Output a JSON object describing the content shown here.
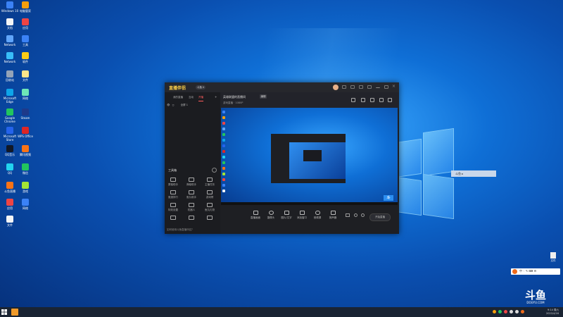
{
  "desktop": {
    "icons": [
      {
        "label": "Windows 10",
        "color": "#3b82f6"
      },
      {
        "label": "电脑管家",
        "color": "#f59e0b"
      },
      {
        "label": "文档",
        "color": "#f3f4f6"
      },
      {
        "label": "应用",
        "color": "#ef4444"
      },
      {
        "label": "Network",
        "color": "#60a5fa"
      },
      {
        "label": "工具",
        "color": "#3b82f6"
      },
      {
        "label": "Network",
        "color": "#38bdf8"
      },
      {
        "label": "软件",
        "color": "#facc15"
      },
      {
        "label": "回收站",
        "color": "#94a3b8"
      },
      {
        "label": "文件",
        "color": "#fde68a"
      },
      {
        "label": "Microsoft Edge",
        "color": "#0ea5e9"
      },
      {
        "label": "网络",
        "color": "#6ee7b7"
      },
      {
        "label": "Google Chrome",
        "color": "#22c55e"
      },
      {
        "label": "Steam",
        "color": "#1e3a8a"
      },
      {
        "label": "Microsoft Store",
        "color": "#2563eb"
      },
      {
        "label": "WPS Office",
        "color": "#dc2626"
      },
      {
        "label": "QQ音乐",
        "color": "#111827"
      },
      {
        "label": "腾讯视频",
        "color": "#f97316"
      },
      {
        "label": "QQ",
        "color": "#22d3ee"
      },
      {
        "label": "微信",
        "color": "#22c55e"
      },
      {
        "label": "斗鱼直播",
        "color": "#f97316"
      },
      {
        "label": "游戏",
        "color": "#a3e635"
      },
      {
        "label": "应用",
        "color": "#ef4444"
      },
      {
        "label": "网络",
        "color": "#3b82f6"
      },
      {
        "label": "文件",
        "color": "#f3f4f6"
      }
    ]
  },
  "app": {
    "logo": "直播伴侣",
    "badge": "斗鱼 ▾",
    "left_tabs": [
      "我的直播",
      "互动",
      "开播"
    ],
    "active_tab": 2,
    "row_text": "全屏 1",
    "tools_title": "工具箱",
    "tools": [
      "屏幕助手",
      "弹幕助手",
      "主播任务",
      "鱼翅排行",
      "鱼丸助手",
      "游戏榜",
      "特效设置",
      "机器人",
      "鱼丸礼物",
      "",
      "",
      ""
    ],
    "left_footer": "如何使用斗鱼直播伴侣？",
    "stream_title": "英雄联盟的直播间",
    "edit_label": "编辑",
    "stream_sub": "游戏直播  ·  1080P",
    "bottom_items": [
      "直播画面",
      "摄像头",
      "图片/文字",
      "添加窗口",
      "音频源",
      "扬声器"
    ],
    "start_label": "开始直播",
    "footer_text": ""
  },
  "popup": {
    "text": "斗鱼 ▸"
  },
  "right_desktop_icon": {
    "label": "文件"
  },
  "taskbar": {
    "time": "9:14 周六",
    "date": "2022/4/16"
  },
  "brand": {
    "big": "斗鱼",
    "small": "DOUYU.COM"
  },
  "colors": {
    "accent": "#ff5d5d",
    "brand_yellow": "#ffd24a",
    "douyu_orange": "#f06a1a"
  }
}
